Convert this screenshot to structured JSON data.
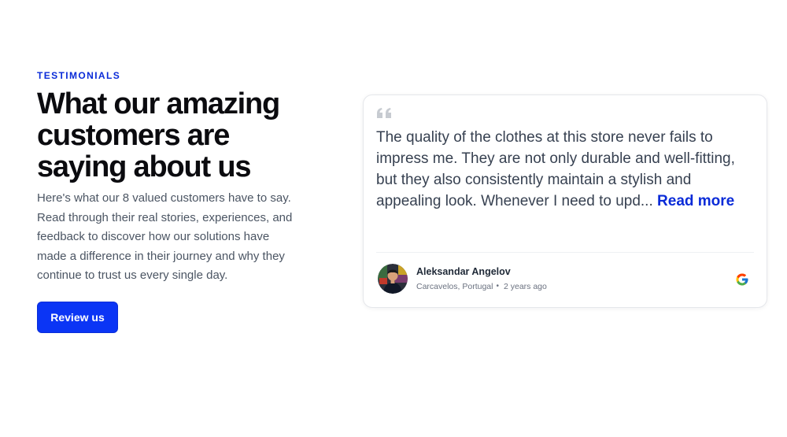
{
  "section": {
    "eyebrow": "TESTIMONIALS",
    "headline": "What our amazing customers are saying about us",
    "description": "Here's what our 8 valued customers have to say. Read through their real stories, experiences, and feedback to discover how our solutions have made a difference in their journey and why they continue to trust us every single day.",
    "cta_label": "Review us"
  },
  "testimonial": {
    "text": "The quality of the clothes at this store never fails to impress me. They are not only durable and well-fitting, but they also consistently maintain a stylish and appealing look. Whenever I need to upd...",
    "read_more_label": "Read more",
    "author_name": "Aleksandar Angelov",
    "location": "Carcavelos, Portugal",
    "separator": "•",
    "time_ago": "2 years ago",
    "source_icon": "google-icon",
    "quote_icon": "quote-icon"
  },
  "colors": {
    "accent": "#0b35f5",
    "eyebrow": "#0a2bd8",
    "body_text": "#4b5563",
    "card_border": "#e5e7eb"
  }
}
